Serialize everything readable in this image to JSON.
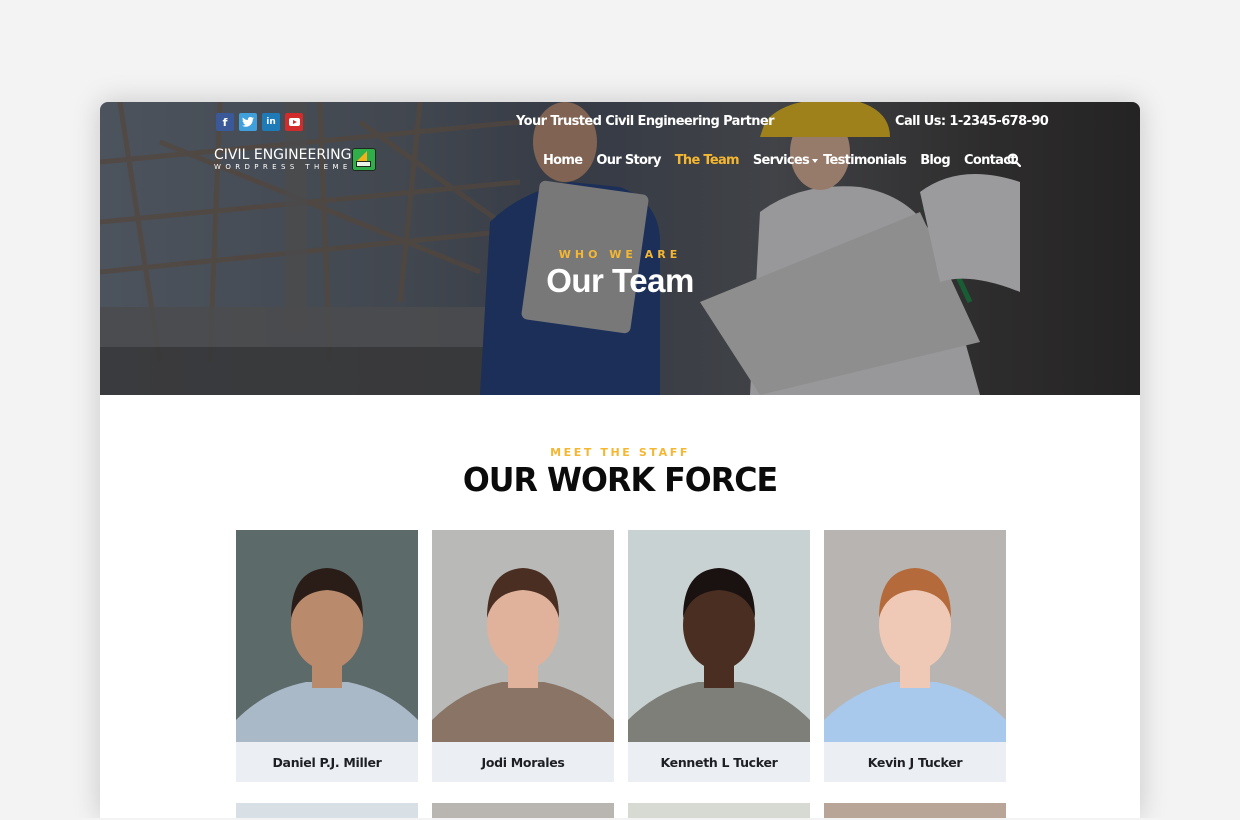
{
  "header": {
    "social": [
      {
        "icon": "facebook-icon",
        "glyph": "f"
      },
      {
        "icon": "twitter-icon",
        "glyph": "t"
      },
      {
        "icon": "linkedin-icon",
        "glyph": "in"
      },
      {
        "icon": "youtube-icon",
        "glyph": "▶"
      }
    ],
    "tagline": "Your Trusted Civil Engineering Partner",
    "call_us": "Call Us: 1-2345-678-90",
    "logo": {
      "main": "CIVIL ENGINEERING",
      "sub": "WORDPRESS THEME"
    },
    "nav": [
      {
        "label": "Home",
        "active": false
      },
      {
        "label": "Our Story",
        "active": false
      },
      {
        "label": "The Team",
        "active": true
      },
      {
        "label": "Services",
        "active": false,
        "has_dropdown": true
      },
      {
        "label": "Testimonials",
        "active": false
      },
      {
        "label": "Blog",
        "active": false
      },
      {
        "label": "Contact",
        "active": false
      }
    ]
  },
  "hero": {
    "kicker": "WHO WE ARE",
    "title": "Our Team"
  },
  "section": {
    "kicker": "MEET THE STAFF",
    "title": "OUR WORK FORCE"
  },
  "team": [
    {
      "name": "Daniel P.J. Miller",
      "bg": "#5d6a6a",
      "skin": "#b98a6c",
      "hair": "#2a1d18",
      "shirt": "#a9b9c8"
    },
    {
      "name": "Jodi Morales",
      "bg": "#b9b9b7",
      "skin": "#e0b29c",
      "hair": "#4a2e22",
      "shirt": "#8a7466"
    },
    {
      "name": "Kenneth L Tucker",
      "bg": "#c9d2d3",
      "skin": "#4a2e22",
      "hair": "#1a1210",
      "shirt": "#7d7f78"
    },
    {
      "name": "Kevin J Tucker",
      "bg": "#b7b4b1",
      "skin": "#efc9b5",
      "hair": "#b46a3a",
      "shirt": "#a8c8ec"
    }
  ],
  "team_partial": [
    {
      "bg": "#d8dfe5"
    },
    {
      "bg": "#b9b6b1"
    },
    {
      "bg": "#d6dad2"
    },
    {
      "bg": "#b9a597"
    }
  ],
  "colors": {
    "accent": "#f5b731",
    "card_bg": "#ebeef2"
  }
}
